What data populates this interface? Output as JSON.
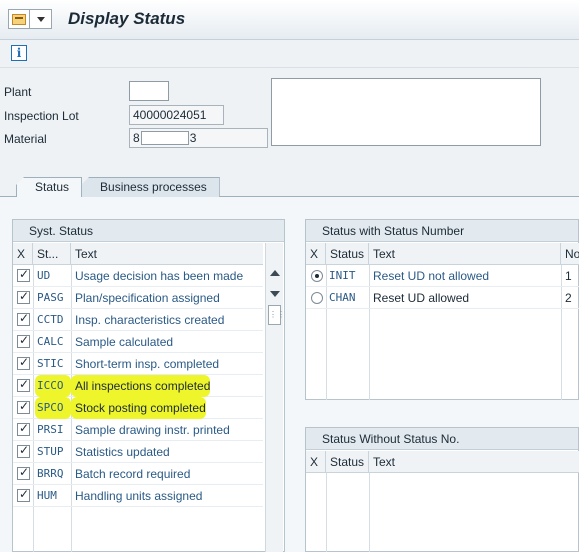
{
  "window": {
    "title": "Display Status"
  },
  "header": {
    "plant": {
      "label": "Plant",
      "value": ""
    },
    "inspection_lot": {
      "label": "Inspection Lot",
      "value": "40000024051"
    },
    "material": {
      "label": "Material",
      "prefix": "8",
      "suffix": "3"
    }
  },
  "tabs": [
    {
      "label": "Status",
      "active": true
    },
    {
      "label": "Business processes",
      "active": false
    }
  ],
  "syst_status": {
    "title": "Syst. Status",
    "columns": [
      "X",
      "St...",
      "Text"
    ],
    "rows": [
      {
        "checked": true,
        "code": "UD",
        "text": "Usage decision has been made",
        "highlight": false
      },
      {
        "checked": true,
        "code": "PASG",
        "text": "Plan/specification assigned",
        "highlight": false
      },
      {
        "checked": true,
        "code": "CCTD",
        "text": "Insp. characteristics created",
        "highlight": false
      },
      {
        "checked": true,
        "code": "CALC",
        "text": "Sample calculated",
        "highlight": false
      },
      {
        "checked": true,
        "code": "STIC",
        "text": "Short-term insp. completed",
        "highlight": false
      },
      {
        "checked": true,
        "code": "ICCO",
        "text": "All inspections completed",
        "highlight": true
      },
      {
        "checked": true,
        "code": "SPCO",
        "text": "Stock posting completed",
        "highlight": true
      },
      {
        "checked": true,
        "code": "PRSI",
        "text": "Sample drawing instr. printed",
        "highlight": false
      },
      {
        "checked": true,
        "code": "STUP",
        "text": "Statistics updated",
        "highlight": false
      },
      {
        "checked": true,
        "code": "BRRQ",
        "text": "Batch record required",
        "highlight": false
      },
      {
        "checked": true,
        "code": "HUM",
        "text": "Handling units assigned",
        "highlight": false
      }
    ]
  },
  "status_with_number": {
    "title": "Status with Status Number",
    "columns": [
      "X",
      "Status",
      "Text",
      "No"
    ],
    "rows": [
      {
        "selected": true,
        "code": "INIT",
        "text": "Reset UD not allowed",
        "no": "1"
      },
      {
        "selected": false,
        "code": "CHAN",
        "text": "Reset UD allowed",
        "no": "2"
      }
    ]
  },
  "status_without_number": {
    "title": "Status Without Status No.",
    "columns": [
      "X",
      "Status",
      "Text"
    ]
  },
  "colors": {
    "highlight": "#eef52a",
    "code_text": "#2a5a86",
    "header_bg": "#e2e9ef"
  }
}
